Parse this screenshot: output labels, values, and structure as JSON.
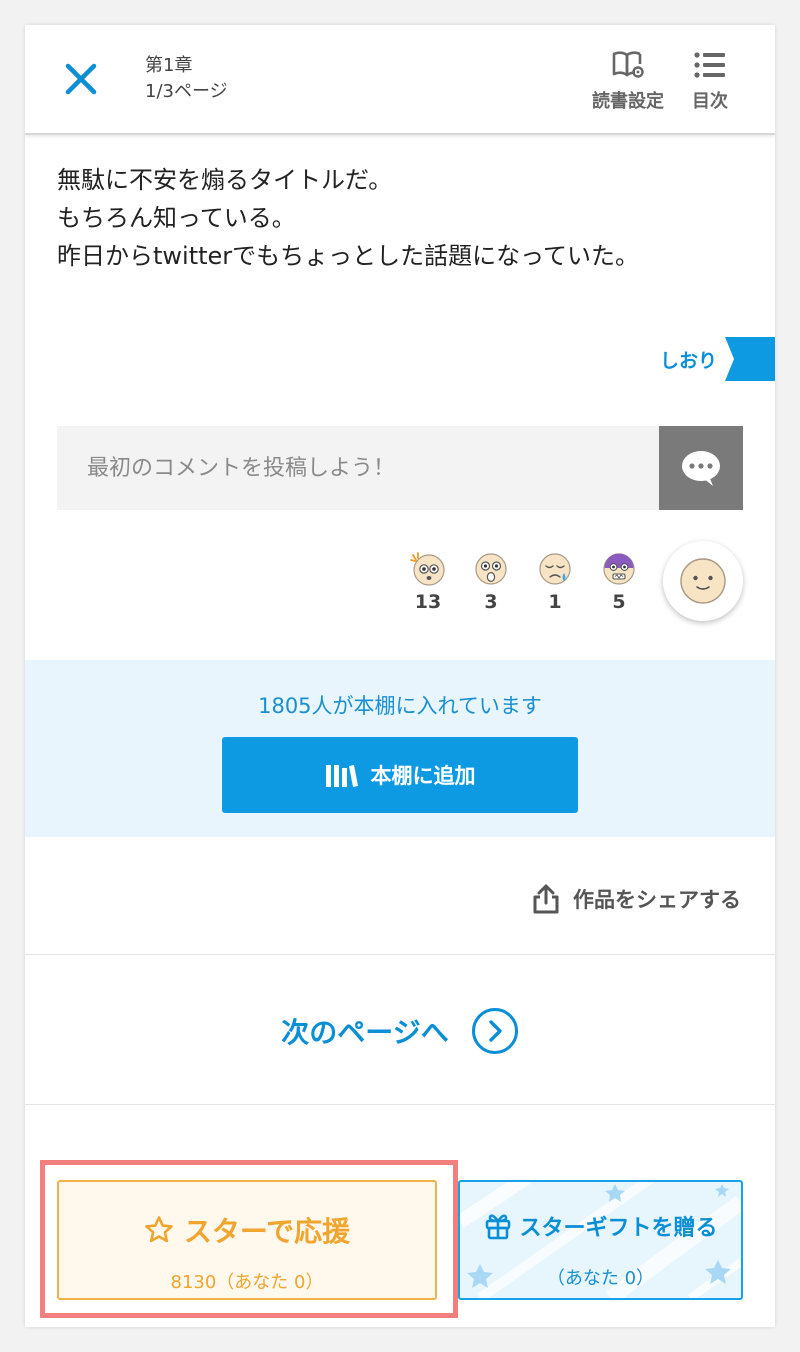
{
  "header": {
    "chapter": "第1章",
    "page": "1/3ページ",
    "reading_settings_label": "読書設定",
    "toc_label": "目次"
  },
  "story": {
    "lines": [
      "無駄に不安を煽るタイトルだ。",
      "もちろん知っている。",
      "昨日からtwitterでもちょっとした話題になっていた。"
    ]
  },
  "bookmark": {
    "label": "しおり"
  },
  "comment": {
    "placeholder": "最初のコメントを投稿しよう！"
  },
  "reactions": [
    {
      "icon": "surprised-sweat-icon",
      "count": "13"
    },
    {
      "icon": "shocked-face-icon",
      "count": "3"
    },
    {
      "icon": "crying-face-icon",
      "count": "1"
    },
    {
      "icon": "scared-face-icon",
      "count": "5"
    }
  ],
  "bookshelf": {
    "count_text": "1805人が本棚に入れています",
    "add_label": "本棚に追加"
  },
  "share": {
    "label": "作品をシェアする"
  },
  "next_page": {
    "label": "次のページへ"
  },
  "star": {
    "label": "スターで応援",
    "count_text": "8130（あなた 0）"
  },
  "gift": {
    "label": "スターギフトを贈る",
    "count_text": "（あなた 0）"
  },
  "colors": {
    "accent": "#0d9ae3",
    "star": "#f0a52f",
    "highlight": "#f47f7f"
  }
}
